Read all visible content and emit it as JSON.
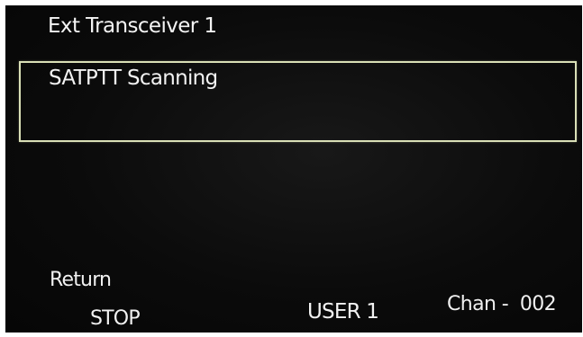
{
  "screen": {
    "title": "Ext Transceiver 1",
    "status": "SATPTT Scanning"
  },
  "softkeys": {
    "return_label": "Return",
    "stop_label": "STOP"
  },
  "footer": {
    "user": "USER 1",
    "channel": "Chan -  002"
  },
  "colors": {
    "screen_background": "#0b0b0b",
    "text": "#f2f2f2",
    "box_border": "#d9dfb6"
  }
}
